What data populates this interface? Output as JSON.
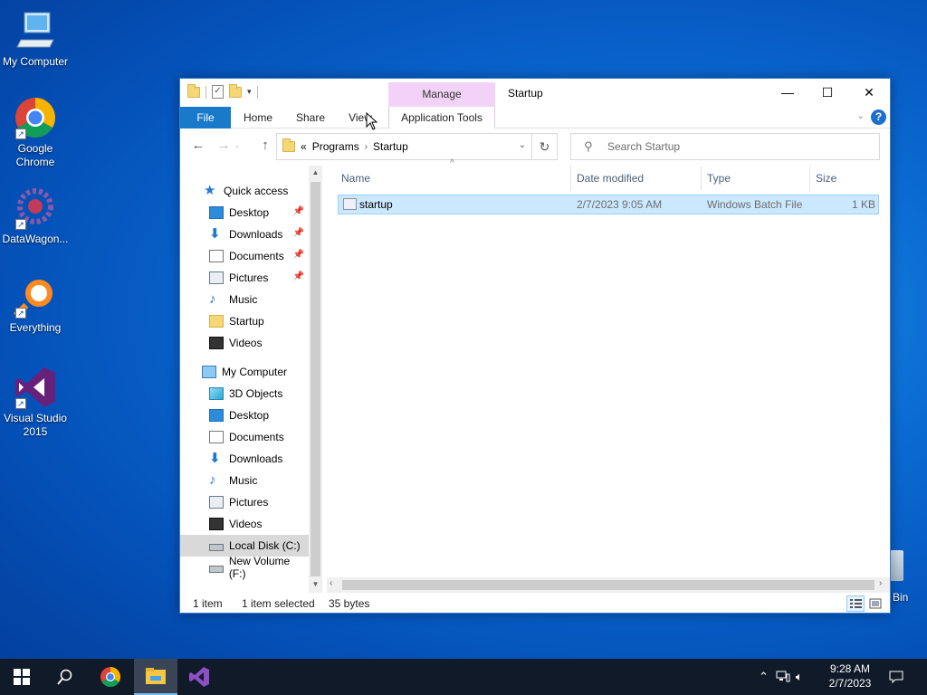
{
  "desktop": {
    "icons": [
      {
        "label": "My Computer"
      },
      {
        "label": "Google Chrome"
      },
      {
        "label": "DataWagon..."
      },
      {
        "label": "Everything"
      },
      {
        "label": "Visual Studio 2015"
      }
    ],
    "recycle_partial_label": "Bin"
  },
  "window": {
    "title": "Startup",
    "contextual_tab_group": "Manage",
    "ribbon_tabs": [
      "File",
      "Home",
      "Share",
      "View",
      "Application Tools"
    ],
    "address": {
      "overflow": "«",
      "crumbs": [
        "Programs",
        "Startup"
      ]
    },
    "search_placeholder": "Search Startup"
  },
  "nav": {
    "quick_access": "Quick access",
    "quick_items": [
      {
        "label": "Desktop",
        "pinned": true
      },
      {
        "label": "Downloads",
        "pinned": true
      },
      {
        "label": "Documents",
        "pinned": true
      },
      {
        "label": "Pictures",
        "pinned": true
      },
      {
        "label": "Music",
        "pinned": false
      },
      {
        "label": "Startup",
        "pinned": false
      },
      {
        "label": "Videos",
        "pinned": false
      }
    ],
    "my_computer": "My Computer",
    "pc_items": [
      {
        "label": "3D Objects"
      },
      {
        "label": "Desktop"
      },
      {
        "label": "Documents"
      },
      {
        "label": "Downloads"
      },
      {
        "label": "Music"
      },
      {
        "label": "Pictures"
      },
      {
        "label": "Videos"
      },
      {
        "label": "Local Disk (C:)",
        "selected": true
      },
      {
        "label": "New Volume (F:)"
      }
    ]
  },
  "content": {
    "columns": [
      "Name",
      "Date modified",
      "Type",
      "Size"
    ],
    "rows": [
      {
        "name": "startup",
        "date": "2/7/2023 9:05 AM",
        "type": "Windows Batch File",
        "size": "1 KB"
      }
    ]
  },
  "status": {
    "item_count": "1 item",
    "selected": "1 item selected",
    "size": "35 bytes"
  },
  "taskbar": {
    "time": "9:28 AM",
    "date": "2/7/2023"
  },
  "colors": {
    "file_tab": "#1979ca",
    "manage_tab": "#f2d3f7",
    "selection": "#cce8ff",
    "taskbar": "#101a29"
  }
}
